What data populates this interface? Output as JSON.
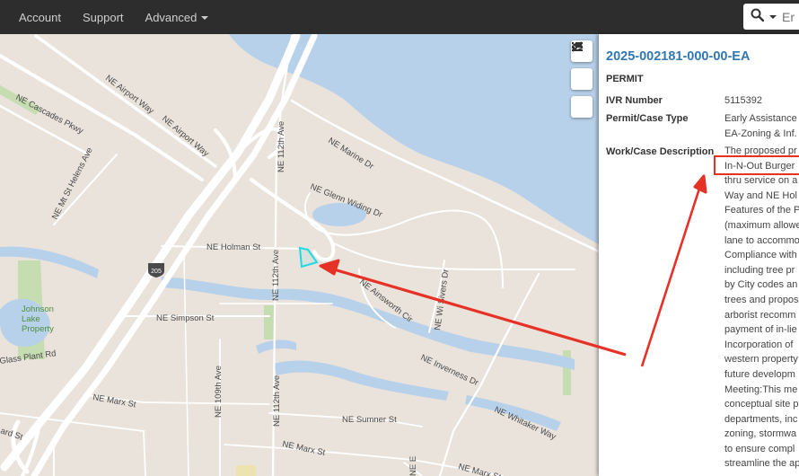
{
  "nav": {
    "account": "Account",
    "support": "Support",
    "advanced": "Advanced"
  },
  "search": {
    "placeholder": "Er"
  },
  "map": {
    "roads": [
      "NE Airport Way",
      "NE Airport Way",
      "NE Cascades Pkwy",
      "NE 112th Ave",
      "NE Marine Dr",
      "NE Mt St Helens Ave",
      "NE Glenn Widing Dr",
      "NE Holman St",
      "NE 112th Ave",
      "NE Ainsworth Cir",
      "NE Wi Sivers Dr",
      "NE Simpson St",
      "Glass Plant Rd",
      "NE Inverness Dr",
      "NE 109th Ave",
      "NE 112th Ave",
      "NE Marx St",
      "NE Sumner St",
      "NE Whitaker Way",
      "NE Marx St",
      "ard St",
      "NE Marx St",
      "NE E"
    ],
    "shield": "205",
    "place": [
      "Johnson",
      "Lake",
      "Property"
    ],
    "colors": {
      "land": "#e9e3dc",
      "water": "#b8d1ea",
      "park": "#c5ddb0",
      "road": "#ffffff",
      "parcel": "#1fd9e6",
      "annotation": "#e63126"
    }
  },
  "panel": {
    "title": "2025-002181-000-00-EA",
    "subtitle": "PERMIT",
    "ivr_label": "IVR Number",
    "ivr_value": "5115392",
    "type_label": "Permit/Case Type",
    "type_lines": [
      "Early Assistance",
      "EA-Zoning & Inf."
    ],
    "desc_label": "Work/Case Description",
    "desc_lines": [
      "The proposed pr",
      "In-N-Out Burger",
      "thru service on a",
      "Way and NE Hol",
      "Features of the P",
      "(maximum allowe",
      "lane to accommo",
      "Compliance with",
      "including tree pr",
      "by City codes an",
      "trees and propos",
      "arborist recomm",
      "payment of in-lie",
      "Incorporation of",
      "western property",
      "future developm",
      "Meeting:This me",
      "conceptual site p",
      "departments, inc",
      "zoning, stormwa",
      "to ensure compl",
      "streamline the ap"
    ]
  }
}
